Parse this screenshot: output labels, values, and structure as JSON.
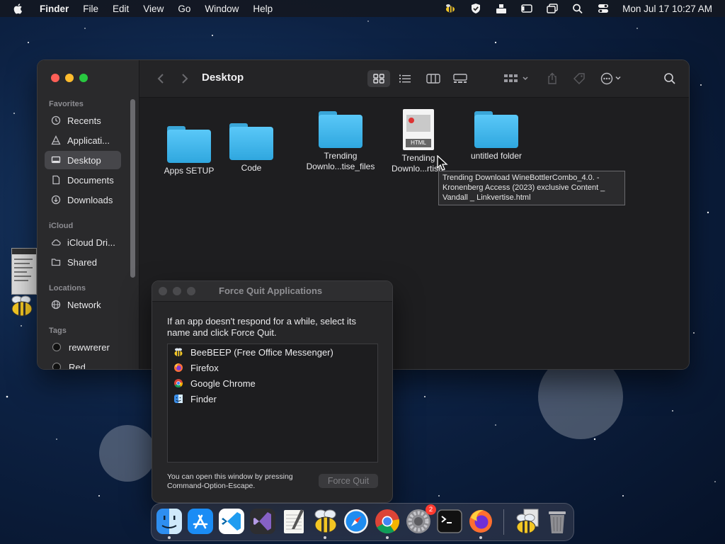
{
  "menubar": {
    "app_name": "Finder",
    "items": [
      "File",
      "Edit",
      "View",
      "Go",
      "Window",
      "Help"
    ],
    "clock": "Mon Jul 17  10:27 AM"
  },
  "finder": {
    "location_title": "Desktop",
    "sidebar": {
      "favorites_heading": "Favorites",
      "favorites": [
        {
          "label": "Recents",
          "icon": "clock-icon"
        },
        {
          "label": "Applicati...",
          "icon": "applications-icon"
        },
        {
          "label": "Desktop",
          "icon": "desktop-icon",
          "selected": true
        },
        {
          "label": "Documents",
          "icon": "document-icon"
        },
        {
          "label": "Downloads",
          "icon": "download-icon"
        }
      ],
      "icloud_heading": "iCloud",
      "icloud": [
        {
          "label": "iCloud Dri...",
          "icon": "cloud-icon"
        },
        {
          "label": "Shared",
          "icon": "shared-folder-icon"
        }
      ],
      "locations_heading": "Locations",
      "locations": [
        {
          "label": "Network",
          "icon": "globe-icon"
        }
      ],
      "tags_heading": "Tags",
      "tags": [
        {
          "label": "rewwrerer",
          "color": "#111111"
        },
        {
          "label": "Red",
          "color": "#111111"
        }
      ]
    },
    "files": [
      {
        "label": "Apps SETUP",
        "kind": "folder"
      },
      {
        "label": "Code",
        "kind": "folder"
      },
      {
        "label": "Trending Downlo...tise_files",
        "kind": "folder"
      },
      {
        "label": "Trending Downlo...rtise.",
        "kind": "html"
      },
      {
        "label": "untitled folder",
        "kind": "folder"
      }
    ],
    "html_badge": "HTML",
    "tooltip": "Trending Download WineBottlerCombo_4.0. - Kronenberg Access (2023) exclusive Content _ Vandall _ Linkvertise.html"
  },
  "force_quit": {
    "title": "Force Quit Applications",
    "message": "If an app doesn't respond for a while, select its name and click Force Quit.",
    "apps": [
      {
        "label": "BeeBEEP (Free Office Messenger)",
        "icon": "bee-icon"
      },
      {
        "label": "Firefox",
        "icon": "firefox-icon"
      },
      {
        "label": "Google Chrome",
        "icon": "chrome-icon"
      },
      {
        "label": "Finder",
        "icon": "finder-icon"
      }
    ],
    "hint": "You can open this window by pressing Command-Option-Escape.",
    "button": "Force Quit"
  },
  "dock": {
    "settings_badge": "2",
    "apps": [
      "Finder",
      "App Store",
      "Visual Studio Code",
      "Visual Studio",
      "TextEdit",
      "BeeBEEP",
      "Safari",
      "Google Chrome",
      "System Settings",
      "Terminal",
      "Firefox",
      "BeeBEEP",
      "Trash"
    ]
  }
}
